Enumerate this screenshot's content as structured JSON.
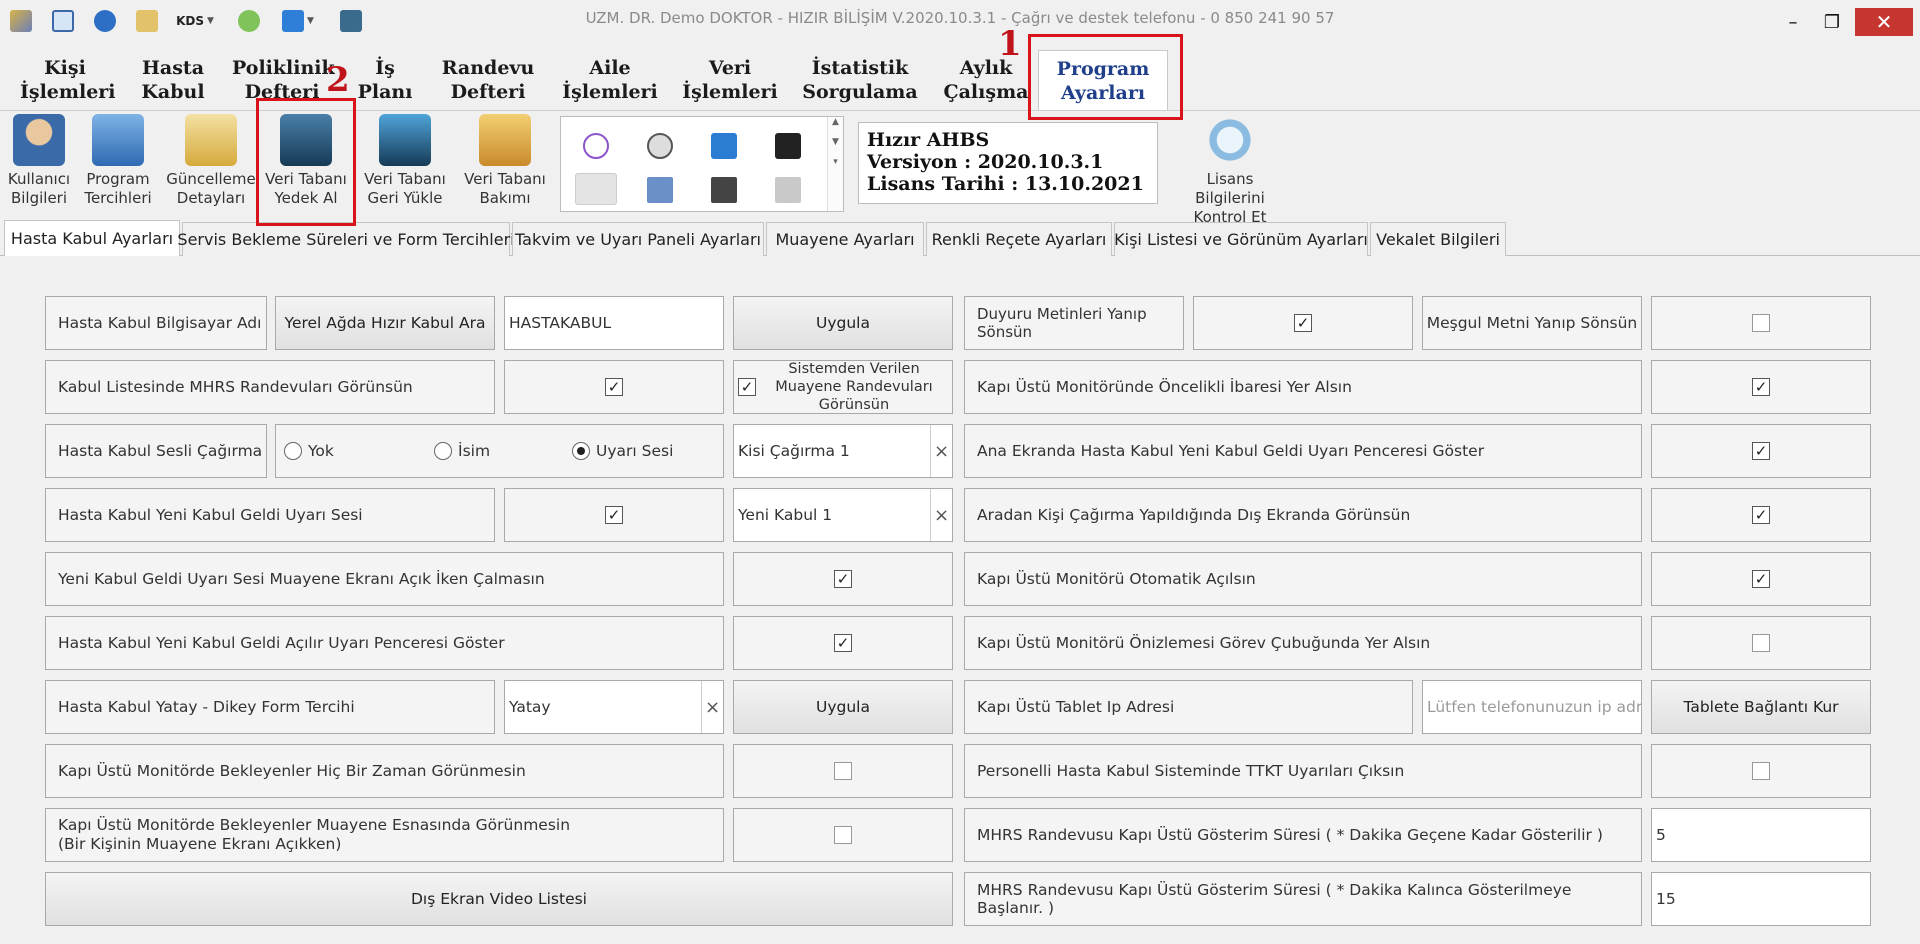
{
  "window": {
    "title": "UZM. DR. Demo DOKTOR - HIZIR BİLİŞİM V.2020.10.3.1 - Çağrı ve destek telefonu - 0 850 241 90 57",
    "qa_kds_label": "KDS"
  },
  "menu": [
    {
      "label": "Kişi\nİşlemleri"
    },
    {
      "label": "Hasta\nKabul"
    },
    {
      "label": "Poliklinik\nDefteri"
    },
    {
      "label": "İş\nPlanı"
    },
    {
      "label": "Randevu\nDefteri"
    },
    {
      "label": "Aile\nİşlemleri"
    },
    {
      "label": "Veri\nİşlemleri"
    },
    {
      "label": "İstatistik\nSorgulama"
    },
    {
      "label": "Aylık\nÇalışma"
    },
    {
      "label": "Program\nAyarları"
    }
  ],
  "annotations": {
    "one": "1",
    "two": "2"
  },
  "toolbar": [
    {
      "label": "Kullanıcı\nBilgileri"
    },
    {
      "label": "Program\nTercihleri"
    },
    {
      "label": "Güncelleme\nDetayları"
    },
    {
      "label": "Veri Tabanı\nYedek Al"
    },
    {
      "label": "Veri Tabanı\nGeri Yükle"
    },
    {
      "label": "Veri Tabanı\nBakımı"
    },
    {
      "label": "Lisans Bilgilerini\nKontrol Et"
    }
  ],
  "version_box": {
    "line1": "Hızır AHBS",
    "line2": "Versiyon : 2020.10.3.1",
    "line3": "Lisans Tarihi : 13.10.2021"
  },
  "tabs": [
    {
      "label": "Hasta Kabul Ayarları"
    },
    {
      "label": "Servis Bekleme Süreleri ve Form Tercihleri"
    },
    {
      "label": "Takvim ve Uyarı Paneli Ayarları"
    },
    {
      "label": "Muayene Ayarları"
    },
    {
      "label": "Renkli Reçete Ayarları"
    },
    {
      "label": "Kişi Listesi ve Görünüm Ayarları"
    },
    {
      "label": "Vekalet Bilgileri"
    }
  ],
  "left": {
    "pc_name_label": "Hasta Kabul Bilgisayar Adı",
    "search_button": "Yerel Ağda Hızır Kabul Ara",
    "pc_name_value": "HASTAKABUL",
    "apply_button": "Uygula",
    "mhrs_label": "Kabul Listesinde MHRS Randevuları Görünsün",
    "system_appt_label": "Sistemden Verilen Muayene Randevuları Görünsün",
    "voice_call_label": "Hasta Kabul Sesli Çağırma",
    "radio_none": "Yok",
    "radio_name": "İsim",
    "radio_sound": "Uyarı Sesi",
    "call_sound_value": "Kisi Çağırma 1",
    "new_sound_label": "Hasta Kabul Yeni Kabul Geldi Uyarı Sesi",
    "new_sound_value": "Yeni Kabul 1",
    "no_play_label": "Yeni Kabul Geldi Uyarı Sesi Muayene Ekranı Açık İken Çalmasın",
    "popup_label": "Hasta Kabul Yeni Kabul Geldi Açılır Uyarı Penceresi Göster",
    "orientation_label": "Hasta Kabul Yatay - Dikey Form Tercihi",
    "orientation_value": "Yatay",
    "apply_button2": "Uygula",
    "never_show_label": "Kapı Üstü Monitörde Bekleyenler Hiç Bir Zaman Görünmesin",
    "exam_hide_label1": "Kapı Üstü Monitörde Bekleyenler Muayene Esnasında Görünmesin",
    "exam_hide_label2": "(Bir Kişinin Muayene Ekranı Açıkken)",
    "video_list_button": "Dış Ekran Video Listesi"
  },
  "right": {
    "blink_label": "Duyuru Metinleri Yanıp Sönsün",
    "busy_blink_label": "Meşgul Metni Yanıp Sönsün",
    "priority_label": "Kapı Üstü Monitöründe Öncelikli İbaresi Yer Alsın",
    "main_popup_label": "Ana Ekranda Hasta Kabul Yeni Kabul Geldi Uyarı Penceresi Göster",
    "intermediate_label": "Aradan Kişi Çağırma Yapıldığında Dış Ekranda Görünsün",
    "auto_open_label": "Kapı Üstü Monitörü Otomatik Açılsın",
    "preview_label": "Kapı Üstü Monitörü Önizlemesi Görev Çubuğunda Yer Alsın",
    "tablet_ip_label": "Kapı Üstü Tablet Ip Adresi",
    "tablet_ip_placeholder": "Lütfen telefonunuzun ip adresi",
    "tablet_connect_button": "Tablete Bağlantı Kur",
    "ttkt_label": "Personelli Hasta Kabul Sisteminde TTKT Uyarıları Çıksın",
    "mhrs_time1_label": "MHRS Randevusu Kapı Üstü Gösterim Süresi ( * Dakika Geçene Kadar Gösterilir )",
    "mhrs_time1_value": "5",
    "mhrs_time2_label": "MHRS Randevusu Kapı Üstü Gösterim Süresi ( * Dakika Kalınca Gösterilmeye Başlanır. )",
    "mhrs_time2_value": "15"
  },
  "checkmark": "✓",
  "clear_glyph": "×"
}
